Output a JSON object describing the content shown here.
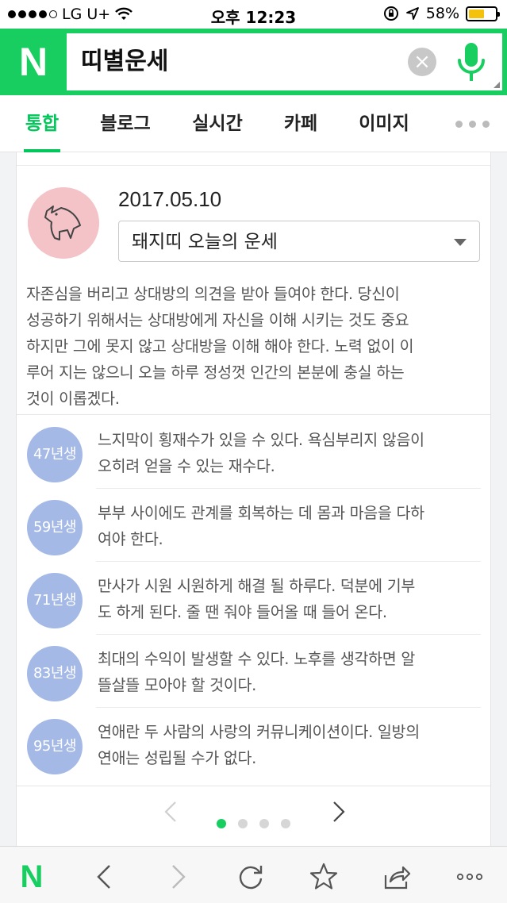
{
  "status_bar": {
    "carrier": "LG U+",
    "time": "오후 12:23",
    "battery": "58%",
    "battery_level": 0.58,
    "battery_color": "#f4c20d"
  },
  "search": {
    "logo": "N",
    "query": "띠별운세",
    "accent_color": "#19ce60"
  },
  "tabs": [
    {
      "label": "통합",
      "active": true
    },
    {
      "label": "블로그"
    },
    {
      "label": "실시간"
    },
    {
      "label": "카페"
    },
    {
      "label": "이미지"
    }
  ],
  "fortune": {
    "date": "2017.05.10",
    "selected_sign": "돼지띠 오늘의 운세",
    "summary": "자존심을 버리고 상대방의 의견을 받아 들여야 한다. 당신이 성공하기 위해서는 상대방에게 자신을 이해 시키는 것도 중요하지만 그에 못지 않고 상대방을 이해 해야 한다. 노력 없이 이루어 지는 않으니 오늘 하루 정성껏 인간의 본분에 충실 하는 것이 이롭겠다.",
    "summary_lines": [
      "자존심을 버리고 상대방의 의견을 받아 들여야 한다. 당신이",
      "성공하기 위해서는 상대방에게 자신을 이해 시키는 것도 중요",
      "하지만 그에 못지 않고 상대방을 이해 해야 한다. 노력 없이 이",
      "루어 지는 않으니 오늘 하루 정성껏 인간의 본분에 충실 하는",
      "것이 이롭겠다."
    ],
    "years": [
      {
        "year": "47년생",
        "lines": [
          "느지막이 횡재수가 있을 수 있다. 욕심부리지 않음이",
          "오히려 얻을 수 있는 재수다."
        ]
      },
      {
        "year": "59년생",
        "lines": [
          "부부 사이에도 관계를 회복하는 데 몸과 마음을 다하",
          "여야 한다."
        ]
      },
      {
        "year": "71년생",
        "lines": [
          "만사가 시원 시원하게 해결 될 하루다. 덕분에 기부",
          "도 하게 된다. 줄 땐 줘야 들어올 때 들어 온다."
        ]
      },
      {
        "year": "83년생",
        "lines": [
          "최대의 수익이 발생할 수 있다. 노후를 생각하면 알",
          "뜰살뜰 모아야 할 것이다."
        ]
      },
      {
        "year": "95년생",
        "lines": [
          "연애란 두 사람의 사랑의 커뮤니케이션이다. 일방의",
          "연애는 성립될 수가 없다."
        ]
      }
    ],
    "badge_color": "#a5b9e6",
    "pagination": {
      "pages": 4,
      "current": 1
    }
  },
  "toolbar": {
    "logo": "N",
    "icons": [
      "home-logo-icon",
      "back-icon",
      "forward-icon",
      "refresh-icon",
      "bookmark-star-icon",
      "share-icon",
      "more-icon"
    ]
  }
}
